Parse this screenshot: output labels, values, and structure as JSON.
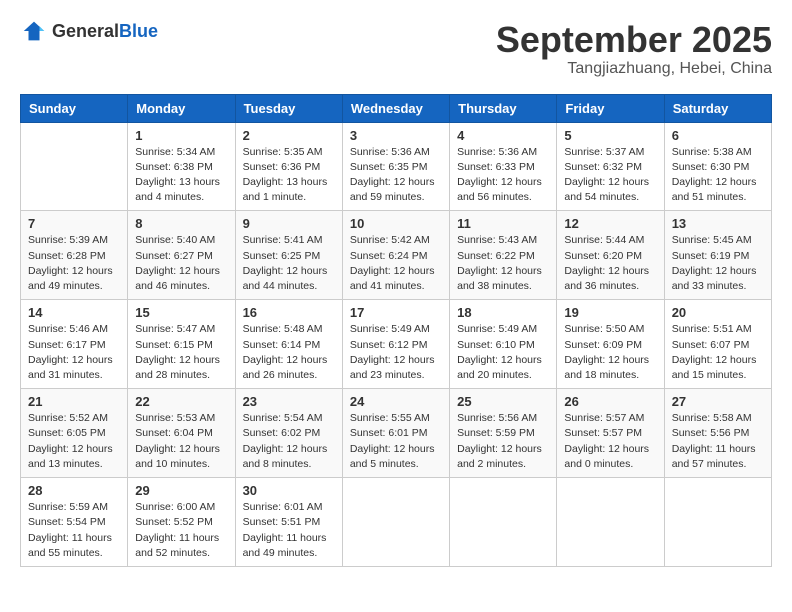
{
  "header": {
    "logo_general": "General",
    "logo_blue": "Blue",
    "month": "September 2025",
    "location": "Tangjiazhuang, Hebei, China"
  },
  "days_of_week": [
    "Sunday",
    "Monday",
    "Tuesday",
    "Wednesday",
    "Thursday",
    "Friday",
    "Saturday"
  ],
  "weeks": [
    [
      {
        "day": "",
        "info": ""
      },
      {
        "day": "1",
        "info": "Sunrise: 5:34 AM\nSunset: 6:38 PM\nDaylight: 13 hours\nand 4 minutes."
      },
      {
        "day": "2",
        "info": "Sunrise: 5:35 AM\nSunset: 6:36 PM\nDaylight: 13 hours\nand 1 minute."
      },
      {
        "day": "3",
        "info": "Sunrise: 5:36 AM\nSunset: 6:35 PM\nDaylight: 12 hours\nand 59 minutes."
      },
      {
        "day": "4",
        "info": "Sunrise: 5:36 AM\nSunset: 6:33 PM\nDaylight: 12 hours\nand 56 minutes."
      },
      {
        "day": "5",
        "info": "Sunrise: 5:37 AM\nSunset: 6:32 PM\nDaylight: 12 hours\nand 54 minutes."
      },
      {
        "day": "6",
        "info": "Sunrise: 5:38 AM\nSunset: 6:30 PM\nDaylight: 12 hours\nand 51 minutes."
      }
    ],
    [
      {
        "day": "7",
        "info": "Sunrise: 5:39 AM\nSunset: 6:28 PM\nDaylight: 12 hours\nand 49 minutes."
      },
      {
        "day": "8",
        "info": "Sunrise: 5:40 AM\nSunset: 6:27 PM\nDaylight: 12 hours\nand 46 minutes."
      },
      {
        "day": "9",
        "info": "Sunrise: 5:41 AM\nSunset: 6:25 PM\nDaylight: 12 hours\nand 44 minutes."
      },
      {
        "day": "10",
        "info": "Sunrise: 5:42 AM\nSunset: 6:24 PM\nDaylight: 12 hours\nand 41 minutes."
      },
      {
        "day": "11",
        "info": "Sunrise: 5:43 AM\nSunset: 6:22 PM\nDaylight: 12 hours\nand 38 minutes."
      },
      {
        "day": "12",
        "info": "Sunrise: 5:44 AM\nSunset: 6:20 PM\nDaylight: 12 hours\nand 36 minutes."
      },
      {
        "day": "13",
        "info": "Sunrise: 5:45 AM\nSunset: 6:19 PM\nDaylight: 12 hours\nand 33 minutes."
      }
    ],
    [
      {
        "day": "14",
        "info": "Sunrise: 5:46 AM\nSunset: 6:17 PM\nDaylight: 12 hours\nand 31 minutes."
      },
      {
        "day": "15",
        "info": "Sunrise: 5:47 AM\nSunset: 6:15 PM\nDaylight: 12 hours\nand 28 minutes."
      },
      {
        "day": "16",
        "info": "Sunrise: 5:48 AM\nSunset: 6:14 PM\nDaylight: 12 hours\nand 26 minutes."
      },
      {
        "day": "17",
        "info": "Sunrise: 5:49 AM\nSunset: 6:12 PM\nDaylight: 12 hours\nand 23 minutes."
      },
      {
        "day": "18",
        "info": "Sunrise: 5:49 AM\nSunset: 6:10 PM\nDaylight: 12 hours\nand 20 minutes."
      },
      {
        "day": "19",
        "info": "Sunrise: 5:50 AM\nSunset: 6:09 PM\nDaylight: 12 hours\nand 18 minutes."
      },
      {
        "day": "20",
        "info": "Sunrise: 5:51 AM\nSunset: 6:07 PM\nDaylight: 12 hours\nand 15 minutes."
      }
    ],
    [
      {
        "day": "21",
        "info": "Sunrise: 5:52 AM\nSunset: 6:05 PM\nDaylight: 12 hours\nand 13 minutes."
      },
      {
        "day": "22",
        "info": "Sunrise: 5:53 AM\nSunset: 6:04 PM\nDaylight: 12 hours\nand 10 minutes."
      },
      {
        "day": "23",
        "info": "Sunrise: 5:54 AM\nSunset: 6:02 PM\nDaylight: 12 hours\nand 8 minutes."
      },
      {
        "day": "24",
        "info": "Sunrise: 5:55 AM\nSunset: 6:01 PM\nDaylight: 12 hours\nand 5 minutes."
      },
      {
        "day": "25",
        "info": "Sunrise: 5:56 AM\nSunset: 5:59 PM\nDaylight: 12 hours\nand 2 minutes."
      },
      {
        "day": "26",
        "info": "Sunrise: 5:57 AM\nSunset: 5:57 PM\nDaylight: 12 hours\nand 0 minutes."
      },
      {
        "day": "27",
        "info": "Sunrise: 5:58 AM\nSunset: 5:56 PM\nDaylight: 11 hours\nand 57 minutes."
      }
    ],
    [
      {
        "day": "28",
        "info": "Sunrise: 5:59 AM\nSunset: 5:54 PM\nDaylight: 11 hours\nand 55 minutes."
      },
      {
        "day": "29",
        "info": "Sunrise: 6:00 AM\nSunset: 5:52 PM\nDaylight: 11 hours\nand 52 minutes."
      },
      {
        "day": "30",
        "info": "Sunrise: 6:01 AM\nSunset: 5:51 PM\nDaylight: 11 hours\nand 49 minutes."
      },
      {
        "day": "",
        "info": ""
      },
      {
        "day": "",
        "info": ""
      },
      {
        "day": "",
        "info": ""
      },
      {
        "day": "",
        "info": ""
      }
    ]
  ]
}
